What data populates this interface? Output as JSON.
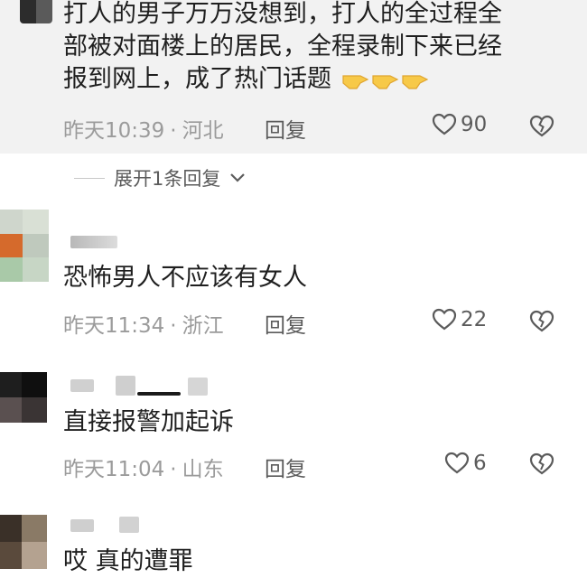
{
  "comments": [
    {
      "text_lines": [
        "打人的男子万万没想到，打人的全过程全",
        "部被对面楼上的居民，全程录制下来已经",
        "报到网上，成了热门话题"
      ],
      "emoji_count": 3,
      "time": "昨天10:39",
      "location": "河北",
      "reply_label": "回复",
      "likes": "90"
    },
    {
      "text_lines": [
        "恐怖男人不应该有女人"
      ],
      "time": "昨天11:34",
      "location": "浙江",
      "reply_label": "回复",
      "likes": "22"
    },
    {
      "text_lines": [
        "直接报警加起诉"
      ],
      "time": "昨天11:04",
      "location": "山东",
      "reply_label": "回复",
      "likes": "6"
    },
    {
      "text_lines": [
        "哎 真的遭罪"
      ]
    }
  ],
  "expand_replies_label": "展开1条回复",
  "separator": "·",
  "icons": {
    "like": "heart-outline-icon",
    "dislike": "broken-heart-icon",
    "expand": "chevron-down-icon",
    "emoji": "pointing-hand-emoji"
  },
  "colors": {
    "highlight_bg": "#f2f2f2",
    "meta_text": "#9b9b9b",
    "body_text": "#1f1f1f"
  }
}
